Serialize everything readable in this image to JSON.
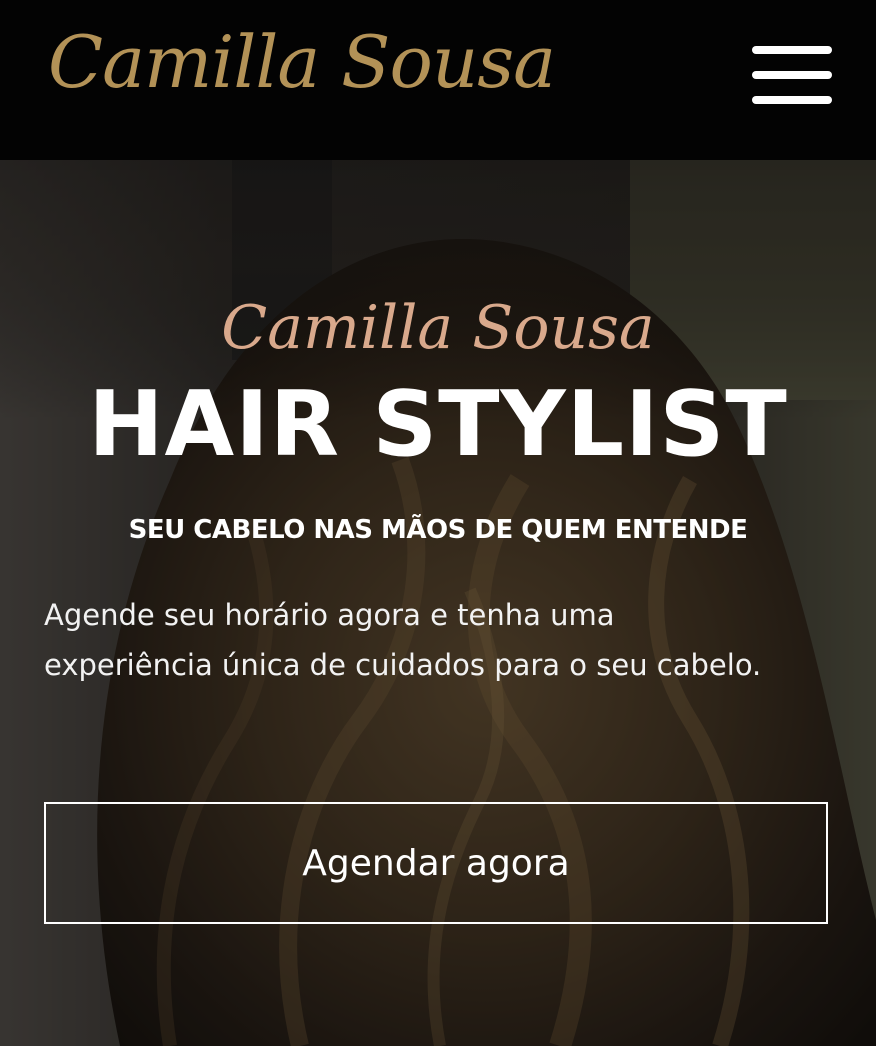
{
  "header": {
    "logo_text": "Camilla Sousa",
    "menu_icon": "hamburger-menu-icon",
    "logo_color": "#b39257"
  },
  "hero": {
    "script_title": "Camilla Sousa",
    "main_title": "HAIR STYLIST",
    "subtitle": "SEU CABELO NAS MÃOS DE QUEM ENTENDE",
    "description": "Agende seu horário agora e tenha uma experiência única de cuidados para o seu cabelo.",
    "cta_label": "Agendar agora",
    "script_color": "#d9a98c"
  }
}
